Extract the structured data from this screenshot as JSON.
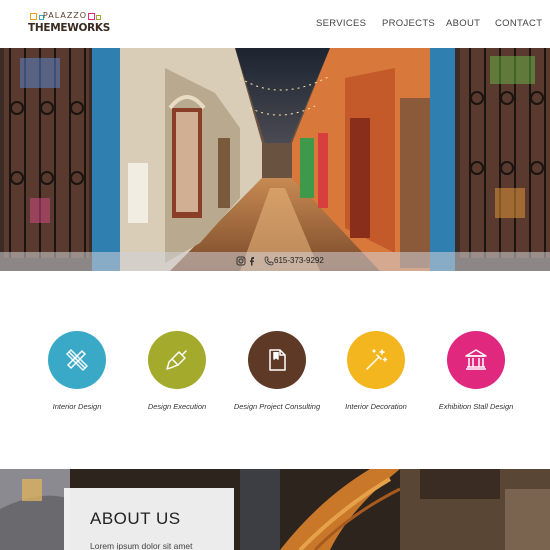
{
  "header": {
    "logo": {
      "top_text": "PALAZZO",
      "main_text": "THEMEWORKS"
    },
    "nav": [
      {
        "label": "SERVICES"
      },
      {
        "label": "PROJECTS"
      },
      {
        "label": "ABOUT"
      },
      {
        "label": "CONTACT"
      }
    ]
  },
  "hero": {
    "social_icons": [
      "instagram-icon",
      "facebook-icon"
    ],
    "phone_icon": "phone-icon",
    "phone": "615-373-9292"
  },
  "services": [
    {
      "label": "Interior Design",
      "icon": "pencil-ruler-icon",
      "color": "#3aa9c8"
    },
    {
      "label": "Design Execution",
      "icon": "paint-brush-icon",
      "color": "#a4aa2b"
    },
    {
      "label": "Design Project Consulting",
      "icon": "document-icon",
      "color": "#5e3a26"
    },
    {
      "label": "Interior Decoration",
      "icon": "magic-wand-icon",
      "color": "#f3b61f"
    },
    {
      "label": "Exhibition Stall Design",
      "icon": "museum-icon",
      "color": "#e0287f"
    }
  ],
  "about": {
    "title": "ABOUT US",
    "text": "Lorem ipsum dolor sit amet"
  }
}
